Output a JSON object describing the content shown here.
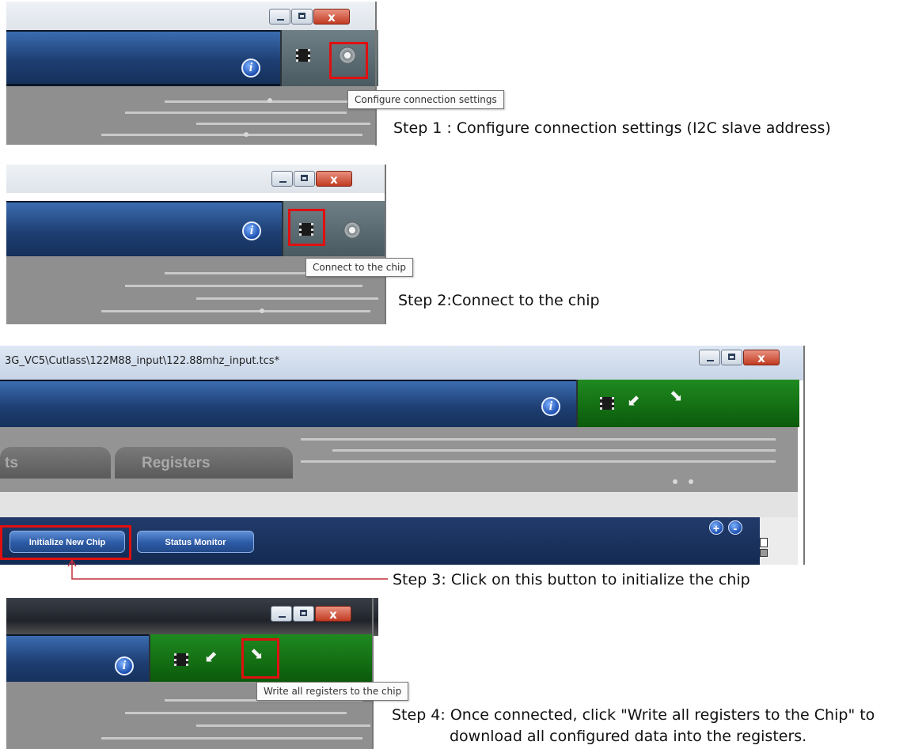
{
  "steps": [
    {
      "tooltip": "Configure connection settings",
      "caption": "Step 1 : Configure connection settings (I2C slave address)"
    },
    {
      "tooltip": "Connect to the chip",
      "caption": "Step 2:Connect to the chip"
    },
    {
      "caption": "Step 3: Click on this button to initialize the chip"
    },
    {
      "tooltip": "Write all registers to the chip",
      "caption_line1": "Step 4: Once connected, click \"Write all registers to the Chip\" to",
      "caption_line2": "download all configured data into the registers."
    }
  ],
  "window3": {
    "title": "3G_VC5\\Cutlass\\122M88_input\\122.88mhz_input.tcs*",
    "tabs": [
      "ts",
      "Registers"
    ],
    "buttons": [
      "Initialize New Chip",
      "Status Monitor"
    ],
    "zoom_in": "+",
    "zoom_out": "-"
  },
  "icons": [
    "info-icon",
    "chip-icon",
    "gear-icon",
    "read-arrow-icon",
    "write-arrow-icon",
    "minimize-icon",
    "maximize-icon",
    "close-icon"
  ],
  "colors": {
    "highlight": "#e01010",
    "header_blue": "#1e3f73",
    "dock_green": "#0b5a0b",
    "board_grey": "#8f8f8f"
  }
}
